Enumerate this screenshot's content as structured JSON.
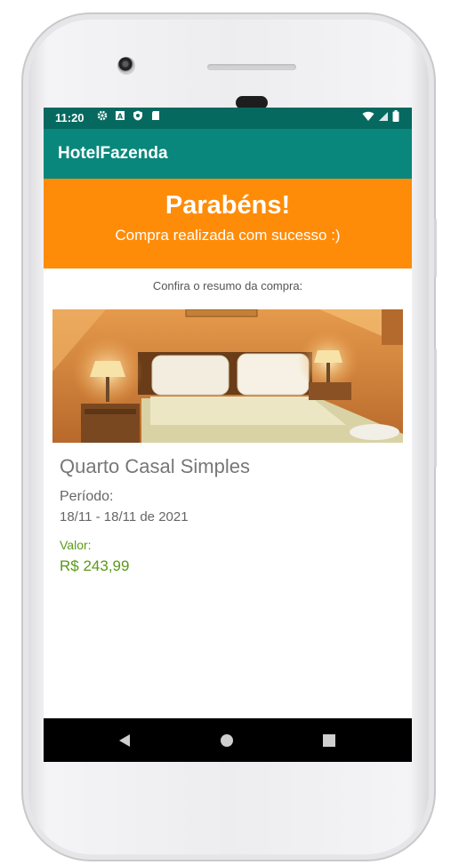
{
  "status_bar": {
    "time": "11:20",
    "icons": [
      "gear-icon",
      "a-box-icon",
      "shield-icon",
      "sd-card-icon"
    ],
    "right_icons": [
      "wifi-icon",
      "signal-icon",
      "battery-icon"
    ]
  },
  "app_bar": {
    "title": "HotelFazenda"
  },
  "banner": {
    "heading": "Parabéns!",
    "subheading": "Compra realizada com sucesso :)",
    "color": "#ff8c08"
  },
  "summary": {
    "label": "Confira o resumo da compra:",
    "room_title": "Quarto Casal Simples",
    "period_label": "Período:",
    "period_value": "18/11 - 18/11 de 2021",
    "value_label": "Valor:",
    "value_amount": "R$ 243,99",
    "value_color": "#5a9a17"
  },
  "nav_bar": {
    "buttons": [
      "back-icon",
      "home-icon",
      "recents-icon"
    ]
  },
  "colors": {
    "status_bar": "#06695f",
    "app_bar": "#0a877c"
  }
}
